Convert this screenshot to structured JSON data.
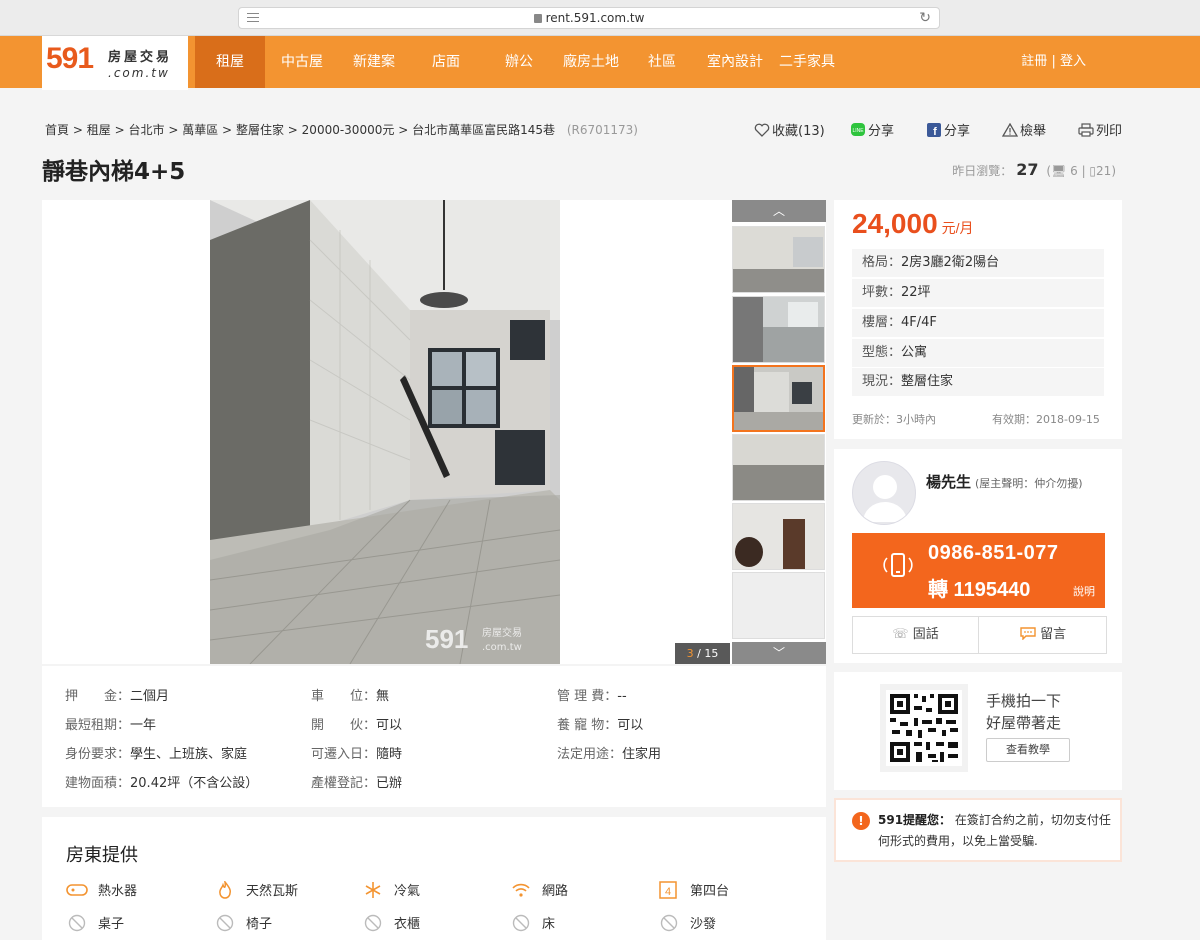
{
  "browser": {
    "url": "rent.591.com.tw"
  },
  "logo": {
    "number": "591",
    "brand": "房屋交易",
    "domain": ".com.tw"
  },
  "nav": {
    "items": [
      {
        "label": "租屋"
      },
      {
        "label": "中古屋"
      },
      {
        "label": "新建案"
      },
      {
        "label": "店面"
      },
      {
        "label": "辦公"
      },
      {
        "label": "廠房土地"
      },
      {
        "label": "社區"
      },
      {
        "label": "室內設計"
      },
      {
        "label": "二手家具"
      }
    ],
    "register": "註冊",
    "separator": "|",
    "login": "登入"
  },
  "breadcrumb": {
    "items": [
      "首頁",
      "租屋",
      "台北市",
      "萬華區",
      "整層住家",
      "20000-30000元",
      "台北市萬華區富民路145巷"
    ],
    "sep": ">",
    "code": "(R6701173)"
  },
  "actions": {
    "favorite": "收藏(13)",
    "line_share": "分享",
    "fb_share": "分享",
    "report": "檢舉",
    "print": "列印"
  },
  "listing": {
    "title": "靜巷內梯4+5",
    "views_label": "昨日瀏覽：",
    "views_count": "27",
    "views_pc": "6",
    "views_mobile": "21"
  },
  "gallery": {
    "current": "3",
    "total": "15",
    "sep": "/",
    "watermark_num": "591",
    "watermark_brand": "房屋交易",
    "watermark_domain": ".com.tw"
  },
  "details": {
    "deposit_label": "押　　金：",
    "deposit": "二個月",
    "parking_label": "車　　位：",
    "parking": "無",
    "mgmt_label": "管 理 費：",
    "mgmt": "--",
    "min_term_label": "最短租期：",
    "min_term": "一年",
    "cooking_label": "開　　伙：",
    "cooking": "可以",
    "pets_label": "養 寵 物：",
    "pets": "可以",
    "identity_label": "身份要求：",
    "identity": "學生、上班族、家庭",
    "move_in_label": "可遷入日：",
    "move_in": "隨時",
    "usage_label": "法定用途：",
    "usage": "住家用",
    "area_label": "建物面積：",
    "area": "20.42坪（不含公設）",
    "title_reg_label": "產權登記：",
    "title_reg": "已辦"
  },
  "amenities": {
    "title": "房東提供",
    "items": [
      {
        "label": "熱水器",
        "icon": "water-heater-icon"
      },
      {
        "label": "天然瓦斯",
        "icon": "gas-flame-icon"
      },
      {
        "label": "冷氣",
        "icon": "snowflake-icon"
      },
      {
        "label": "網路",
        "icon": "wifi-icon"
      },
      {
        "label": "第四台",
        "icon": "cable-tv-icon"
      },
      {
        "label": "桌子",
        "icon": "unavailable-icon"
      },
      {
        "label": "椅子",
        "icon": "unavailable-icon"
      },
      {
        "label": "衣櫃",
        "icon": "unavailable-icon"
      },
      {
        "label": "床",
        "icon": "unavailable-icon"
      },
      {
        "label": "沙發",
        "icon": "unavailable-icon"
      }
    ]
  },
  "price": {
    "amount": "24,000",
    "unit": "元/月"
  },
  "specs": [
    {
      "label": "格局：",
      "value": "2房3廳2衛2陽台"
    },
    {
      "label": "坪數：",
      "value": "22坪"
    },
    {
      "label": "樓層：",
      "value": "4F/4F"
    },
    {
      "label": "型態：",
      "value": "公寓"
    },
    {
      "label": "現況：",
      "value": "整層住家"
    }
  ],
  "meta": {
    "updated": "更新於：3小時內",
    "valid": "有效期：2018-09-15"
  },
  "agent": {
    "name": "楊先生",
    "note": "(屋主聲明：仲介勿擾)",
    "phone": "0986-851-077",
    "ext": "轉 1195440",
    "help": "說明",
    "call_label": "固話",
    "message_label": "留言"
  },
  "qr": {
    "line1": "手機拍一下",
    "line2": "好屋帶著走",
    "button": "查看教學"
  },
  "warning": {
    "title": "591提醒您：",
    "text": "在簽訂合約之前，切勿支付任何形式的費用，以免上當受騙."
  },
  "colors": {
    "brand_orange": "#f39431",
    "price_red": "#e94f1d",
    "phone_orange": "#f3661d"
  }
}
